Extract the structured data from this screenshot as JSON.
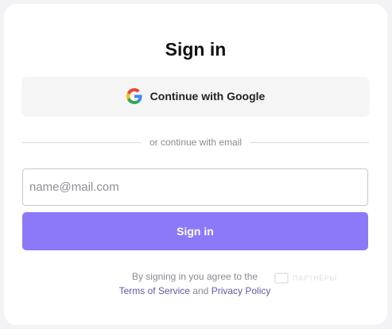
{
  "page": {
    "title": "Sign in"
  },
  "google_button": {
    "label": "Continue with Google",
    "icon": "google-icon"
  },
  "divider": {
    "text": "or continue with email"
  },
  "email": {
    "value": "",
    "placeholder": "name@mail.com"
  },
  "signin_button": {
    "label": "Sign in"
  },
  "terms": {
    "prefix": "By signing in you agree to the",
    "terms_link": "Terms of Service",
    "conjunction": "and",
    "privacy_link": "Privacy Policy"
  },
  "watermark": {
    "text": "ПАРТНЁРЫ"
  },
  "colors": {
    "accent": "#8b79f7",
    "link": "#5f5aa8",
    "background": "#f3f3f6",
    "card": "#ffffff",
    "google_button_bg": "#f5f5f5",
    "muted_text": "#8a8a94"
  }
}
